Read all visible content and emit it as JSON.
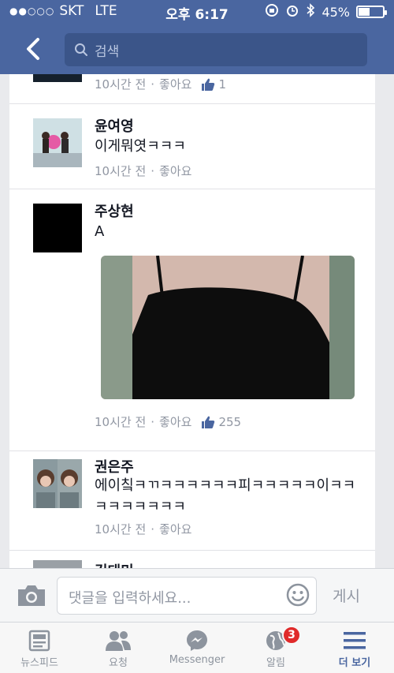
{
  "status_bar": {
    "signal": "●●○○○",
    "carrier": "SKT",
    "network": "LTE",
    "time": "오후 6:17",
    "battery": "45%",
    "battery_level": 0.45
  },
  "nav": {
    "search_placeholder": "검색"
  },
  "comments": [
    {
      "name": "",
      "time": "10시간 전",
      "like_label": "좋아요",
      "like_count": "1"
    },
    {
      "name": "윤여영",
      "text": "이게뭐엿ㅋㅋㅋ",
      "time": "10시간 전",
      "like_label": "좋아요"
    },
    {
      "name": "주상현",
      "text": "A",
      "time": "10시간 전",
      "like_label": "좋아요",
      "like_count": "255"
    },
    {
      "name": "권은주",
      "text": "에이칰ㅋㄲㅋㅋㅋㅋㅋㅋ피ㅋㅋㅋㅋㅋ이ㅋㅋㅋㅋㅋㅋㅋㅋㅋ",
      "time": "10시간 전",
      "like_label": "좋아요"
    },
    {
      "name": "김태미"
    }
  ],
  "compose": {
    "placeholder": "댓글을 입력하세요...",
    "post_label": "게시"
  },
  "tabs": [
    {
      "label": "뉴스피드",
      "icon": "news-feed-icon"
    },
    {
      "label": "요청",
      "icon": "friend-requests-icon"
    },
    {
      "label": "Messenger",
      "icon": "messenger-icon"
    },
    {
      "label": "알림",
      "icon": "globe-icon",
      "badge": "3"
    },
    {
      "label": "더 보기",
      "icon": "menu-icon"
    }
  ],
  "colors": {
    "brand": "#4a66a0",
    "badge": "#e02a2a",
    "meta_text": "#9197a3"
  }
}
